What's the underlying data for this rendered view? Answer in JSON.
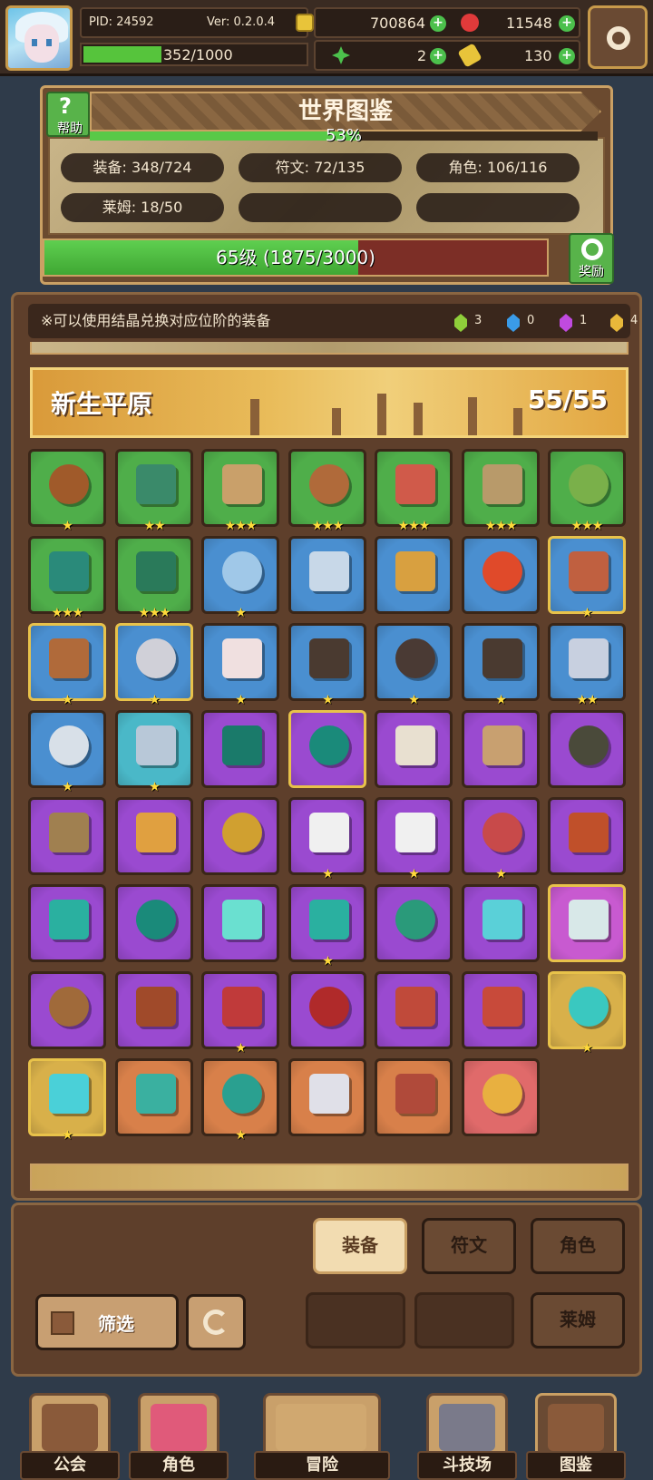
{
  "topbar": {
    "pid": "PID: 24592",
    "version": "Ver: 0.2.0.4",
    "exp": "352/1000",
    "exp_fraction": 0.352,
    "gold": "700864",
    "gems": "11548",
    "clover": "2",
    "tickets": "130"
  },
  "codex": {
    "help_label": "帮助",
    "title": "世界图鉴",
    "percent": "53%",
    "percent_value": 0.53,
    "stats": {
      "equip": "装备: 348/724",
      "rune": "符文: 72/135",
      "character": "角色: 106/116",
      "slime": "莱姆: 18/50"
    },
    "level": "65级 (1875/3000)",
    "level_fraction": 0.625,
    "reward_label": "奖励"
  },
  "main": {
    "notice": "※可以使用结晶兑换对应位阶的装备",
    "crystals": [
      {
        "color": "#8fcf3a",
        "count": "3"
      },
      {
        "color": "#3a9be8",
        "count": "0"
      },
      {
        "color": "#c04adf",
        "count": "1"
      },
      {
        "color": "#e8b83a",
        "count": "4"
      }
    ],
    "region_name": "新生平原",
    "region_count": "55/55",
    "items": [
      {
        "bg": "#4fae4a",
        "art": "#a05a2a",
        "stars": "★",
        "gold": false
      },
      {
        "bg": "#4fae4a",
        "art": "#3a8a6a",
        "stars": "★★",
        "gold": false
      },
      {
        "bg": "#4fae4a",
        "art": "#c9a06a",
        "stars": "★★★",
        "gold": false
      },
      {
        "bg": "#4fae4a",
        "art": "#b06a3a",
        "stars": "★★★",
        "gold": false
      },
      {
        "bg": "#4fae4a",
        "art": "#d05a4a",
        "stars": "★★★",
        "gold": false
      },
      {
        "bg": "#4fae4a",
        "art": "#b89a6a",
        "stars": "★★★",
        "gold": false
      },
      {
        "bg": "#4fae4a",
        "art": "#7ab04a",
        "stars": "★★★",
        "gold": false
      },
      {
        "bg": "#4fae4a",
        "art": "#2a8a7a",
        "stars": "★★★",
        "gold": false
      },
      {
        "bg": "#4fae4a",
        "art": "#2a7a5a",
        "stars": "★★★",
        "gold": false
      },
      {
        "bg": "#4a8fd0",
        "art": "#a0c8e8",
        "stars": "★",
        "gold": false
      },
      {
        "bg": "#4a8fd0",
        "art": "#c8d8e8",
        "stars": "",
        "gold": false
      },
      {
        "bg": "#4a8fd0",
        "art": "#d8a040",
        "stars": "",
        "gold": false
      },
      {
        "bg": "#4a8fd0",
        "art": "#e04a2a",
        "stars": "",
        "gold": false
      },
      {
        "bg": "#4a8fd0",
        "art": "#c06040",
        "stars": "★",
        "gold": true
      },
      {
        "bg": "#4a8fd0",
        "art": "#b06a3a",
        "stars": "★",
        "gold": true
      },
      {
        "bg": "#4a8fd0",
        "art": "#d0d0d8",
        "stars": "★",
        "gold": true
      },
      {
        "bg": "#4a8fd0",
        "art": "#f0e0e0",
        "stars": "★",
        "gold": false
      },
      {
        "bg": "#4a8fd0",
        "art": "#4a3a30",
        "stars": "★",
        "gold": false
      },
      {
        "bg": "#4a8fd0",
        "art": "#4a3a34",
        "stars": "★",
        "gold": false
      },
      {
        "bg": "#4a8fd0",
        "art": "#4a3a30",
        "stars": "★",
        "gold": false
      },
      {
        "bg": "#4a8fd0",
        "art": "#c8d0e0",
        "stars": "★★",
        "gold": false
      },
      {
        "bg": "#4a8fd0",
        "art": "#d8e0e8",
        "stars": "★",
        "gold": false
      },
      {
        "bg": "#4ab8c8",
        "art": "#b8c8d8",
        "stars": "★",
        "gold": false
      },
      {
        "bg": "#9a4ad0",
        "art": "#1a7a6a",
        "stars": "",
        "gold": false
      },
      {
        "bg": "#9a4ad0",
        "art": "#1a8a7a",
        "stars": "",
        "gold": true
      },
      {
        "bg": "#9a4ad0",
        "art": "#e8e0d0",
        "stars": "",
        "gold": false
      },
      {
        "bg": "#9a4ad0",
        "art": "#c8a070",
        "stars": "",
        "gold": false
      },
      {
        "bg": "#9a4ad0",
        "art": "#4a4a3a",
        "stars": "",
        "gold": false
      },
      {
        "bg": "#9a4ad0",
        "art": "#a08050",
        "stars": "",
        "gold": false
      },
      {
        "bg": "#9a4ad0",
        "art": "#e0a040",
        "stars": "",
        "gold": false
      },
      {
        "bg": "#9a4ad0",
        "art": "#d0a030",
        "stars": "",
        "gold": false
      },
      {
        "bg": "#9a4ad0",
        "art": "#f0f0f0",
        "stars": "★",
        "gold": false
      },
      {
        "bg": "#9a4ad0",
        "art": "#f0f0f0",
        "stars": "★",
        "gold": false
      },
      {
        "bg": "#9a4ad0",
        "art": "#c84a4a",
        "stars": "★",
        "gold": false
      },
      {
        "bg": "#9a4ad0",
        "art": "#c0502a",
        "stars": "",
        "gold": false
      },
      {
        "bg": "#9a4ad0",
        "art": "#2ab0a0",
        "stars": "",
        "gold": false
      },
      {
        "bg": "#9a4ad0",
        "art": "#1a8a7a",
        "stars": "",
        "gold": false
      },
      {
        "bg": "#9a4ad0",
        "art": "#6ae0d0",
        "stars": "",
        "gold": false
      },
      {
        "bg": "#9a4ad0",
        "art": "#2ab0a0",
        "stars": "★",
        "gold": false
      },
      {
        "bg": "#9a4ad0",
        "art": "#2a9a7a",
        "stars": "",
        "gold": false
      },
      {
        "bg": "#9a4ad0",
        "art": "#5ad0d8",
        "stars": "",
        "gold": false
      },
      {
        "bg": "#c85ad0",
        "art": "#d8e8e8",
        "stars": "",
        "gold": true
      },
      {
        "bg": "#9a4ad0",
        "art": "#a06a3a",
        "stars": "",
        "gold": false
      },
      {
        "bg": "#9a4ad0",
        "art": "#a04a2a",
        "stars": "",
        "gold": false
      },
      {
        "bg": "#9a4ad0",
        "art": "#c03a3a",
        "stars": "★",
        "gold": false
      },
      {
        "bg": "#9a4ad0",
        "art": "#b02a2a",
        "stars": "",
        "gold": false
      },
      {
        "bg": "#9a4ad0",
        "art": "#c04a3a",
        "stars": "",
        "gold": false
      },
      {
        "bg": "#9a4ad0",
        "art": "#c84a3a",
        "stars": "",
        "gold": false
      },
      {
        "bg": "#d8b04a",
        "art": "#3ac8c0",
        "stars": "★",
        "gold": true
      },
      {
        "bg": "#d8b04a",
        "art": "#4ad0d8",
        "stars": "★",
        "gold": true
      },
      {
        "bg": "#d8804a",
        "art": "#3ab0a0",
        "stars": "",
        "gold": false
      },
      {
        "bg": "#d8804a",
        "art": "#2aa090",
        "stars": "★",
        "gold": false
      },
      {
        "bg": "#d8804a",
        "art": "#e0e0e8",
        "stars": "",
        "gold": false
      },
      {
        "bg": "#d8804a",
        "art": "#b04a3a",
        "stars": "",
        "gold": false
      },
      {
        "bg": "#e06a6a",
        "art": "#e8b040",
        "stars": "",
        "gold": false
      }
    ]
  },
  "tabs": {
    "equip": "装备",
    "rune": "符文",
    "character": "角色",
    "slime": "莱姆",
    "filter": "筛选"
  },
  "nav": [
    {
      "label": "公会",
      "pic": "#8a5a3a"
    },
    {
      "label": "角色",
      "pic": "#e05a7a"
    },
    {
      "label": "冒险",
      "pic": "#d0a870"
    },
    {
      "label": "斗技场",
      "pic": "#7a7a8a"
    },
    {
      "label": "图鉴",
      "pic": "#8a5a3a"
    }
  ],
  "icons": {
    "gold": "coin-icon",
    "gem": "red-gem-icon",
    "clover": "clover-icon",
    "ticket": "ticket-icon",
    "settings": "gear-icon"
  }
}
